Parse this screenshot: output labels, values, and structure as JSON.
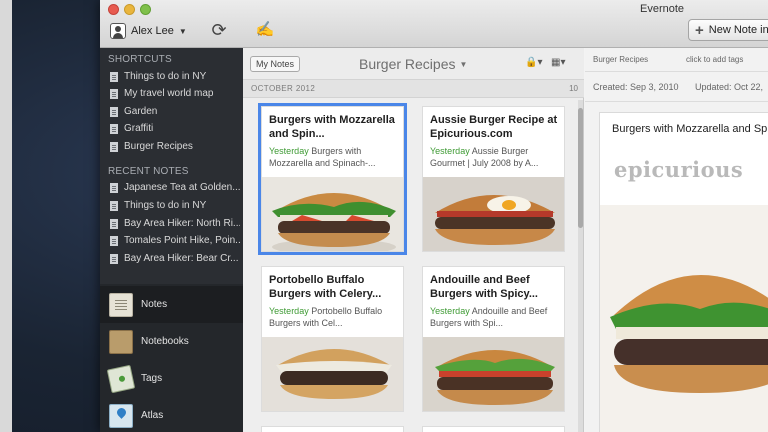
{
  "app": {
    "title": "Evernote"
  },
  "toolbar": {
    "user_name": "Alex Lee",
    "new_note_label": "New Note in"
  },
  "sidebar": {
    "shortcuts_header": "SHORTCUTS",
    "shortcuts": [
      "Things to do in NY",
      "My travel world map",
      "Garden",
      "Graffiti",
      "Burger Recipes"
    ],
    "recent_header": "RECENT NOTES",
    "recent": [
      "Japanese Tea at Golden...",
      "Things to do in NY",
      "Bay Area Hiker: North Ri...",
      "Tomales Point Hike, Poin...",
      "Bay Area Hiker: Bear Cr..."
    ],
    "nav": [
      "Notes",
      "Notebooks",
      "Tags",
      "Atlas"
    ]
  },
  "list": {
    "my_notes_label": "My Notes",
    "notebook_title": "Burger Recipes",
    "date_header": "OCTOBER 2012",
    "count": "10",
    "notes": [
      {
        "title": "Burgers with Mozzarella and Spin...",
        "date": "Yesterday",
        "snippet": "Burgers with Mozzarella and Spinach-..."
      },
      {
        "title": "Aussie Burger Recipe at Epicurious.com",
        "date": "Yesterday",
        "snippet": "Aussie Burger Gourmet | July 2008 by A..."
      },
      {
        "title": "Portobello Buffalo Burgers with Celery...",
        "date": "Yesterday",
        "snippet": "Portobello Buffalo Burgers with Cel..."
      },
      {
        "title": "Andouille and Beef Burgers with Spicy...",
        "date": "Yesterday",
        "snippet": "Andouille and Beef Burgers with Spi..."
      }
    ]
  },
  "detail": {
    "notebook": "Burger Recipes",
    "tags_placeholder": "click to add tags",
    "created": "Created: Sep 3, 2010",
    "updated": "Updated: Oct 22,",
    "note_title": "Burgers with Mozzarella and Sp",
    "site_logo": "epicurious"
  },
  "colors": {
    "selection": "#4a86e8",
    "date_green": "#3f9b35",
    "sidebar_bg": "#2b2e33"
  }
}
